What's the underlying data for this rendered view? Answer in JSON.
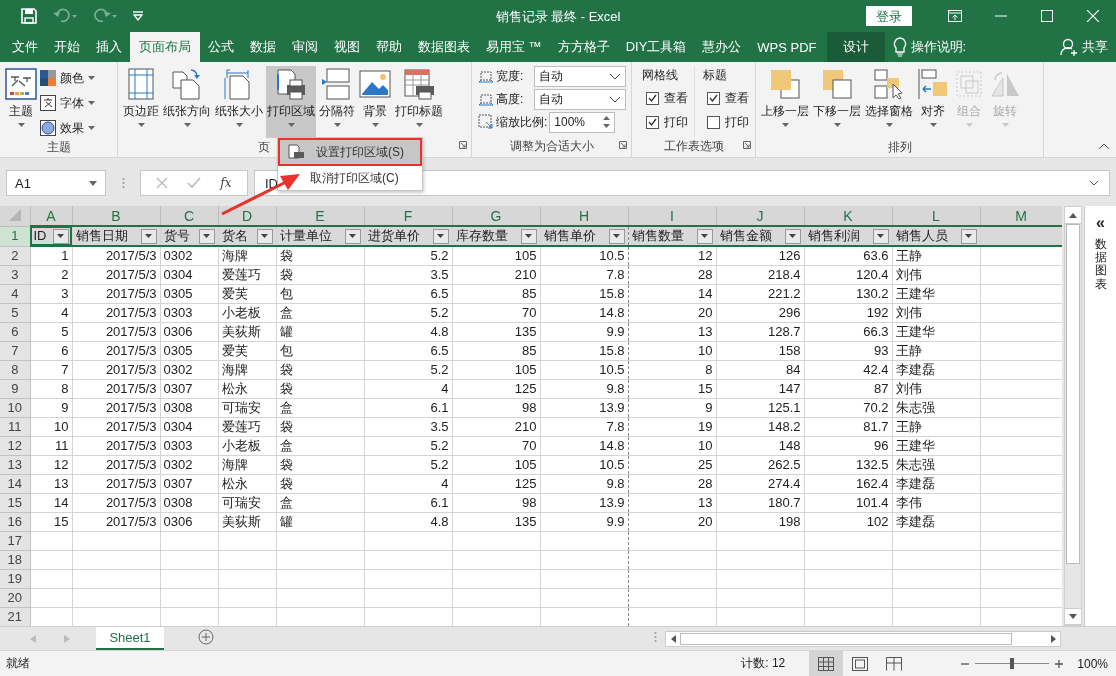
{
  "title_bar": {
    "title": "销售记录 最终  -  Excel",
    "login_button": "登录"
  },
  "menu_tabs": [
    {
      "label": "文件",
      "selected": false,
      "kind": "tab"
    },
    {
      "label": "开始",
      "selected": false,
      "kind": "tab"
    },
    {
      "label": "插入",
      "selected": false,
      "kind": "tab"
    },
    {
      "label": "页面布局",
      "selected": true,
      "kind": "tab"
    },
    {
      "label": "公式",
      "selected": false,
      "kind": "tab"
    },
    {
      "label": "数据",
      "selected": false,
      "kind": "tab"
    },
    {
      "label": "审阅",
      "selected": false,
      "kind": "tab"
    },
    {
      "label": "视图",
      "selected": false,
      "kind": "tab"
    },
    {
      "label": "帮助",
      "selected": false,
      "kind": "tab"
    },
    {
      "label": "数据图表",
      "selected": false,
      "kind": "tab"
    },
    {
      "label": "易用宝 ™",
      "selected": false,
      "kind": "tab"
    },
    {
      "label": "方方格子",
      "selected": false,
      "kind": "tab"
    },
    {
      "label": "DIY工具箱",
      "selected": false,
      "kind": "tab"
    },
    {
      "label": "慧办公",
      "selected": false,
      "kind": "tab"
    },
    {
      "label": "WPS PDF",
      "selected": false,
      "kind": "tab"
    },
    {
      "label": "设计",
      "selected": false,
      "kind": "contextual"
    }
  ],
  "tell_me": "操作说明:",
  "share": "共享",
  "ribbon": {
    "groups": [
      {
        "label": "主题",
        "items": [
          {
            "label": "主题",
            "kind": "large"
          },
          {
            "label": "颜色",
            "kind": "small"
          },
          {
            "label": "字体",
            "kind": "small"
          },
          {
            "label": "效果",
            "kind": "small"
          }
        ]
      },
      {
        "label": "页",
        "items": [
          {
            "label": "页边距",
            "kind": "large",
            "selected": false
          },
          {
            "label": "纸张方向",
            "kind": "large",
            "selected": false
          },
          {
            "label": "纸张大小",
            "kind": "large",
            "selected": false
          },
          {
            "label": "打印区域",
            "kind": "large",
            "selected": true
          },
          {
            "label": "分隔符",
            "kind": "large",
            "selected": false
          },
          {
            "label": "背景",
            "kind": "large",
            "selected": false
          },
          {
            "label": "打印标题",
            "kind": "large",
            "selected": false
          }
        ]
      },
      {
        "label": "调整为合适大小",
        "items": [
          {
            "label": "宽度:",
            "kind": "dropdown",
            "value": "自动"
          },
          {
            "label": "高度:",
            "kind": "dropdown",
            "value": "自动"
          },
          {
            "label": "缩放比例:",
            "kind": "spinner",
            "value": "100%"
          }
        ]
      },
      {
        "label": "工作表选项",
        "items": [
          {
            "label": "网格线",
            "kind": "checkgroup",
            "options": [
              {
                "label": "查看",
                "checked": true
              },
              {
                "label": "打印",
                "checked": true
              }
            ]
          },
          {
            "label": "标题",
            "kind": "checkgroup",
            "options": [
              {
                "label": "查看",
                "checked": true
              },
              {
                "label": "打印",
                "checked": false
              }
            ]
          }
        ]
      },
      {
        "label": "排列",
        "items": [
          {
            "label": "上移一层",
            "kind": "large",
            "disabled": false
          },
          {
            "label": "下移一层",
            "kind": "large",
            "disabled": false
          },
          {
            "label": "选择窗格",
            "kind": "large",
            "disabled": false
          },
          {
            "label": "对齐",
            "kind": "large",
            "disabled": false
          },
          {
            "label": "组合",
            "kind": "large",
            "disabled": true
          },
          {
            "label": "旋转",
            "kind": "large",
            "disabled": true
          }
        ]
      }
    ]
  },
  "print_area_menu": {
    "items": [
      {
        "label": "设置打印区域(S)",
        "selected": true
      },
      {
        "label": "取消打印区域(C)",
        "selected": false
      }
    ]
  },
  "formula_bar": {
    "name_box": "A1",
    "fx": "fx",
    "content": "ID"
  },
  "sheet": {
    "columns": [
      "A",
      "B",
      "C",
      "D",
      "E",
      "F",
      "G",
      "H",
      "I",
      "J",
      "K",
      "L",
      "M"
    ],
    "row_numbers": [
      "1",
      "2",
      "3",
      "4",
      "5",
      "6",
      "7",
      "8",
      "9",
      "10",
      "11",
      "12",
      "13",
      "14",
      "15",
      "16",
      "17",
      "18",
      "19",
      "20",
      "21"
    ],
    "header": [
      "ID",
      "销售日期",
      "货号",
      "货名",
      "计量单位",
      "进货单价",
      "库存数量",
      "销售单价",
      "销售数量",
      "销售金额",
      "销售利润",
      "销售人员"
    ],
    "rows": [
      [
        "1",
        "2017/5/3",
        "0302",
        "海牌",
        "袋",
        "5.2",
        "105",
        "10.5",
        "12",
        "126",
        "63.6",
        "王静"
      ],
      [
        "2",
        "2017/5/3",
        "0304",
        "爱莲巧",
        "袋",
        "3.5",
        "210",
        "7.8",
        "28",
        "218.4",
        "120.4",
        "刘伟"
      ],
      [
        "3",
        "2017/5/3",
        "0305",
        "爱芙",
        "包",
        "6.5",
        "85",
        "15.8",
        "14",
        "221.2",
        "130.2",
        "王建华"
      ],
      [
        "4",
        "2017/5/3",
        "0303",
        "小老板",
        "盒",
        "5.2",
        "70",
        "14.8",
        "20",
        "296",
        "192",
        "刘伟"
      ],
      [
        "5",
        "2017/5/3",
        "0306",
        "美荻斯",
        "罐",
        "4.8",
        "135",
        "9.9",
        "13",
        "128.7",
        "66.3",
        "王建华"
      ],
      [
        "6",
        "2017/5/3",
        "0305",
        "爱芙",
        "包",
        "6.5",
        "85",
        "15.8",
        "10",
        "158",
        "93",
        "王静"
      ],
      [
        "7",
        "2017/5/3",
        "0302",
        "海牌",
        "袋",
        "5.2",
        "105",
        "10.5",
        "8",
        "84",
        "42.4",
        "李建磊"
      ],
      [
        "8",
        "2017/5/3",
        "0307",
        "松永",
        "袋",
        "4",
        "125",
        "9.8",
        "15",
        "147",
        "87",
        "刘伟"
      ],
      [
        "9",
        "2017/5/3",
        "0308",
        "可瑞安",
        "盒",
        "6.1",
        "98",
        "13.9",
        "9",
        "125.1",
        "70.2",
        "朱志强"
      ],
      [
        "10",
        "2017/5/3",
        "0304",
        "爱莲巧",
        "袋",
        "3.5",
        "210",
        "7.8",
        "19",
        "148.2",
        "81.7",
        "王静"
      ],
      [
        "11",
        "2017/5/3",
        "0303",
        "小老板",
        "盒",
        "5.2",
        "70",
        "14.8",
        "10",
        "148",
        "96",
        "王建华"
      ],
      [
        "12",
        "2017/5/3",
        "0302",
        "海牌",
        "袋",
        "5.2",
        "105",
        "10.5",
        "25",
        "262.5",
        "132.5",
        "朱志强"
      ],
      [
        "13",
        "2017/5/3",
        "0307",
        "松永",
        "袋",
        "4",
        "125",
        "9.8",
        "28",
        "274.4",
        "162.4",
        "李建磊"
      ],
      [
        "14",
        "2017/5/3",
        "0308",
        "可瑞安",
        "盒",
        "6.1",
        "98",
        "13.9",
        "13",
        "180.7",
        "101.4",
        "李伟"
      ],
      [
        "15",
        "2017/5/3",
        "0306",
        "美荻斯",
        "罐",
        "4.8",
        "135",
        "9.9",
        "20",
        "198",
        "102",
        "李建磊"
      ]
    ]
  },
  "side_panel": {
    "collapse": "«",
    "title": "数据图表"
  },
  "sheet_tabs": [
    {
      "label": "Sheet1",
      "selected": true
    }
  ],
  "status_bar": {
    "status": "就绪",
    "count": "计数: 12",
    "views": [
      {
        "selected": true
      },
      {
        "selected": false
      },
      {
        "selected": false
      }
    ],
    "zoom": {
      "level": 0.5,
      "reading": "100%"
    }
  }
}
